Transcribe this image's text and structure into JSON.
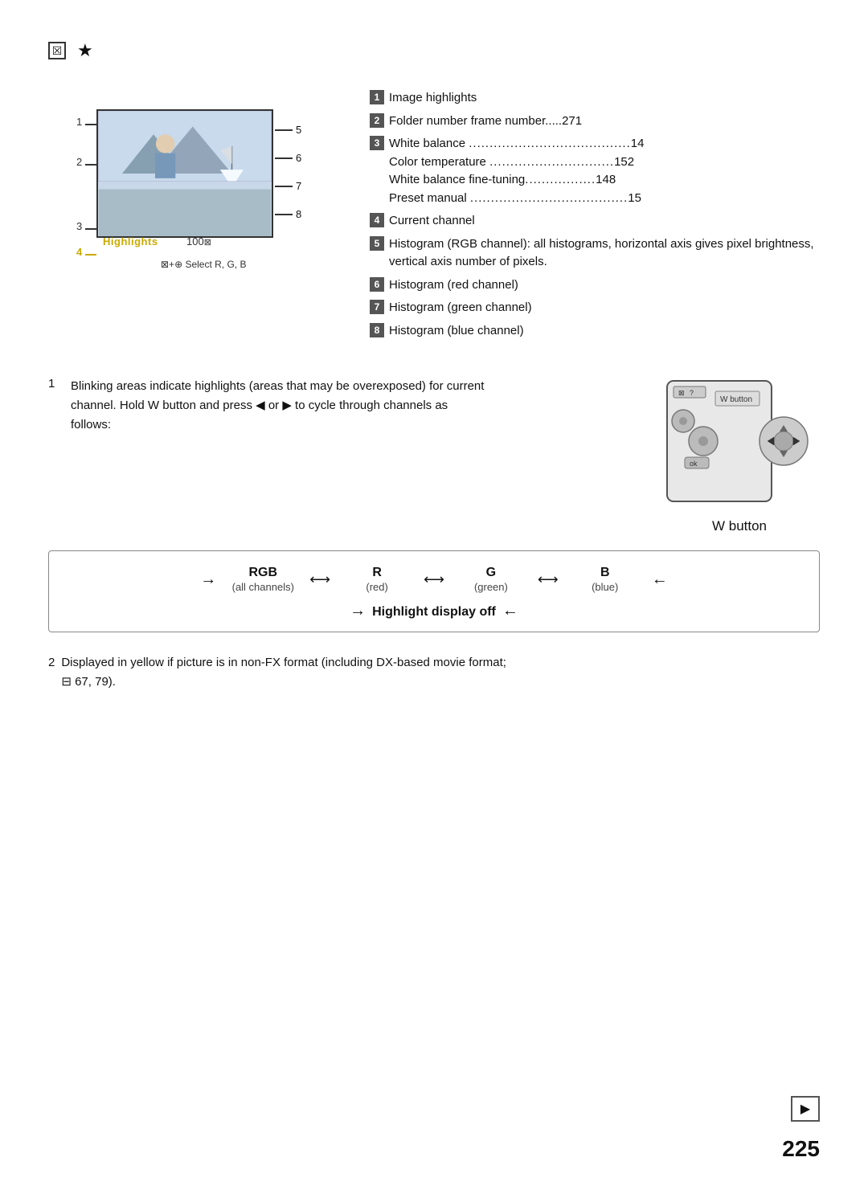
{
  "page": {
    "number": "225",
    "top_icons": {
      "box_icon": "☒",
      "star_icon": "★"
    },
    "info_items": [
      {
        "num": "1",
        "text": "Image highlights"
      },
      {
        "num": "2",
        "text": "Folder number frame number.....271"
      },
      {
        "num": "3",
        "lines": [
          "White balance .......................................14",
          "Color temperature ..............................152",
          "White balance fine-tuning...................148",
          "Preset manual ......................................15"
        ]
      },
      {
        "num": "4",
        "text": "Current channel"
      },
      {
        "num": "5",
        "text": "Histogram (RGB channel): all histograms, horizontal axis gives pixel brightness, vertical axis number of pixels."
      },
      {
        "num": "6",
        "text": "Histogram (red channel)"
      },
      {
        "num": "7",
        "text": "Histogram (green channel)"
      },
      {
        "num": "8",
        "text": "Histogram (blue channel)"
      }
    ],
    "highlights_label": "Highlights",
    "highlights_number": "100",
    "tick_labels": [
      "5",
      "6",
      "7",
      "8"
    ],
    "select_label": "⊠+⊕ Select R, G, B",
    "line_labels": [
      "1",
      "2",
      "3",
      "4"
    ],
    "note1": {
      "num": "1",
      "text": "Blinking areas indicate highlights (areas that may be overexposed) for current channel.  Hold W  button and press ◀ or ▶ to cycle through channels as follows:"
    },
    "w_button_label": "W  button",
    "channels": [
      {
        "main": "RGB",
        "sub": "(all channels)"
      },
      {
        "main": "R",
        "sub": "(red)"
      },
      {
        "main": "G",
        "sub": "(green)"
      },
      {
        "main": "B",
        "sub": "(blue)"
      }
    ],
    "highlight_display_off": "Highlight display off",
    "note2": {
      "num": "2",
      "text": "Displayed in yellow if picture is in non-FX format (including DX-based movie format;",
      "sub": "⊟ 67, 79)."
    },
    "bottom_icon": "▶"
  }
}
